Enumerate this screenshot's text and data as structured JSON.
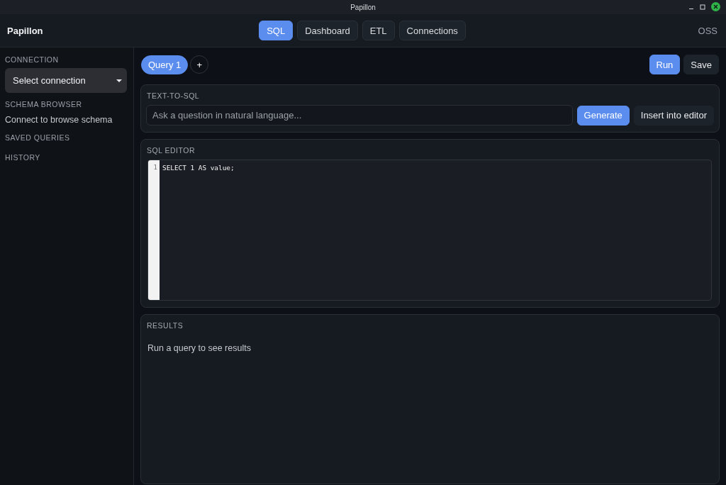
{
  "window": {
    "title": "Papillon"
  },
  "header": {
    "brand": "Papillon",
    "nav": [
      {
        "label": "SQL",
        "selected": true
      },
      {
        "label": "Dashboard",
        "selected": false
      },
      {
        "label": "ETL",
        "selected": false
      },
      {
        "label": "Connections",
        "selected": false
      }
    ],
    "edition": "OSS"
  },
  "sidebar": {
    "sections": [
      {
        "kind": "select",
        "heading": "CONNECTION",
        "value": "Select connection"
      },
      {
        "kind": "text",
        "heading": "SCHEMA BROWSER",
        "text": "Connect to browse schema"
      },
      {
        "kind": "heading",
        "heading": "SAVED QUERIES"
      },
      {
        "kind": "heading",
        "heading": "HISTORY"
      }
    ]
  },
  "query_tabs": [
    {
      "label": "Query 1",
      "selected": true
    }
  ],
  "add_tab": "+",
  "actions": [
    {
      "label": "Run",
      "kind": "primary"
    },
    {
      "label": "Save",
      "kind": "secondary"
    }
  ],
  "text_to_sql": {
    "heading": "TEXT-TO-SQL",
    "input": {
      "placeholder": "Ask a question in natural language..."
    },
    "buttons": [
      {
        "label": "Generate",
        "kind": "primary"
      },
      {
        "label": "Insert into editor",
        "kind": "secondary"
      }
    ]
  },
  "sql_editor": {
    "heading": "SQL EDITOR",
    "lines": [
      {
        "number": "1",
        "code": "SELECT 1 AS value;"
      }
    ]
  },
  "results": {
    "heading": "RESULTS",
    "message": "Run a query to see results"
  }
}
